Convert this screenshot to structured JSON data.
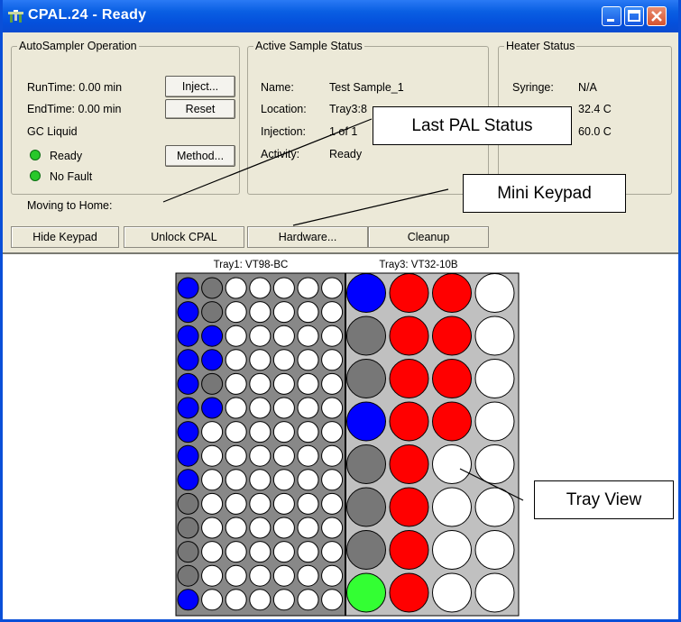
{
  "window": {
    "title": "CPAL.24 - Ready",
    "icon": "pal-robot-icon",
    "title_color": "#0450dc",
    "controls": [
      "minimize-icon",
      "maximize-icon",
      "close-icon"
    ]
  },
  "autosampler": {
    "title": "AutoSampler Operation",
    "runtime": "RunTime:  0.00 min",
    "endtime": "EndTime:  0.00 min",
    "mode": "GC Liquid",
    "ready": "Ready",
    "no_fault": "No Fault",
    "inject_label": "Inject...",
    "reset_label": "Reset",
    "method_label": "Method..."
  },
  "active_sample": {
    "title": "Active Sample Status",
    "name_label": "Name:",
    "name_value": "Test Sample_1",
    "location_label": "Location:",
    "location_value": "Tray3:8",
    "injection_label": "Injection:",
    "injection_value": "1 of 1",
    "activity_label": "Activity:",
    "activity_value": "Ready"
  },
  "heater": {
    "title": "Heater Status",
    "syringe_label": "Syringe:",
    "syringe_value": "N/A",
    "value2": "32.4 C",
    "value3": "60.0 C"
  },
  "status_line": "Moving to Home:",
  "keypad": {
    "hide_keypad": "Hide Keypad",
    "unlock_cpal": "Unlock CPAL",
    "hardware": "Hardware...",
    "cleanup": "Cleanup"
  },
  "callouts": {
    "last_pal_status": "Last PAL Status",
    "mini_keypad": "Mini Keypad",
    "tray_view": "Tray View"
  },
  "colors": {
    "blue": "#0000ff",
    "gray": "#777777",
    "red": "#ff0000",
    "white": "#ffffff",
    "green": "#33ff33",
    "led_green": "#28c82a"
  },
  "trays": {
    "tray1": {
      "label": "Tray1: VT98-BC",
      "rows": [
        "BGWWWWW",
        "BGWWWWW",
        "BBWWWWW",
        "BBWWWWW",
        "BGWWWWW",
        "BBWWWWW",
        "BWWWWWW",
        "BWWWWWW",
        "BWWWWWW",
        "GWWWWWW",
        "GWWWWWW",
        "GWWWWWW",
        "GWWWWWW",
        "BWWWWWW"
      ]
    },
    "tray3": {
      "label": "Tray3: VT32-10B",
      "rows": [
        "BRRW",
        "GRRW",
        "GRRW",
        "BRRW",
        "GRWW",
        "GRWW",
        "GRWW",
        "LRWW"
      ]
    }
  }
}
